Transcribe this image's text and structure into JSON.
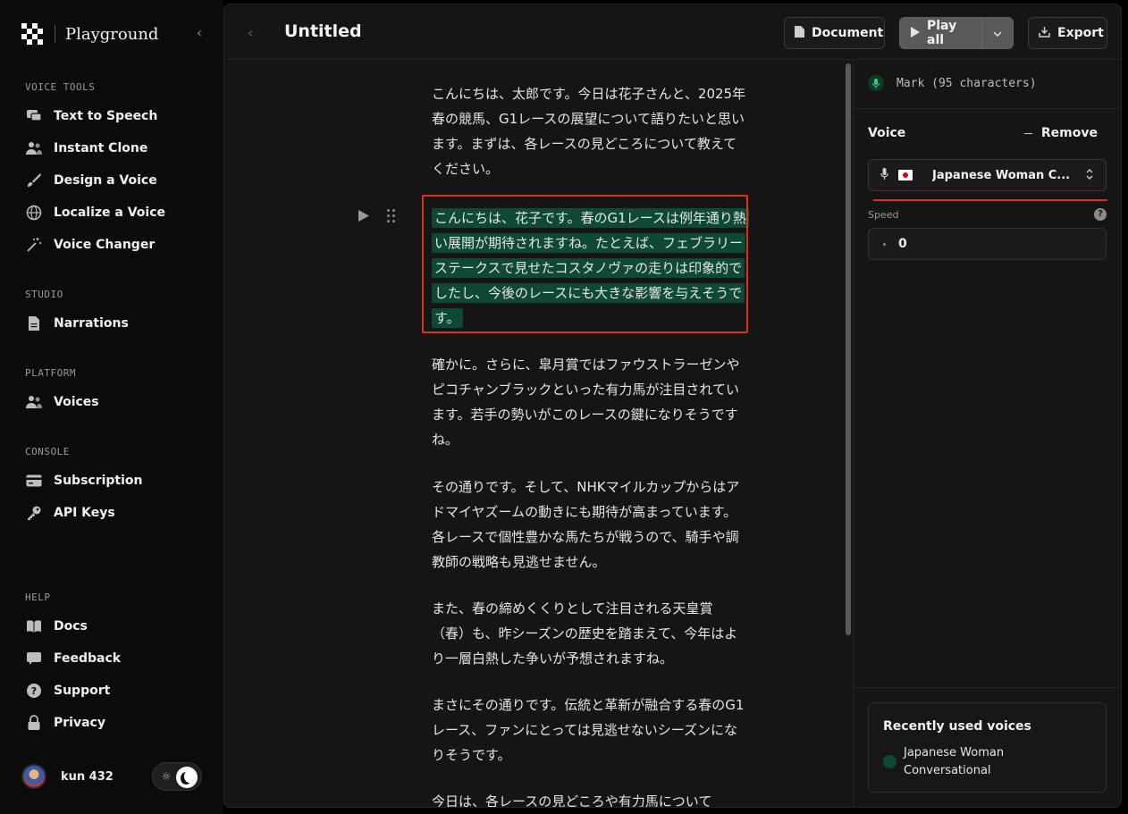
{
  "app": {
    "name": "Playground"
  },
  "sidebar": {
    "sections": [
      {
        "label": "VOICE TOOLS",
        "items": [
          {
            "label": "Text to Speech",
            "icon": "speech-bubble-icon"
          },
          {
            "label": "Instant Clone",
            "icon": "users-icon"
          },
          {
            "label": "Design a Voice",
            "icon": "brush-icon"
          },
          {
            "label": "Localize a Voice",
            "icon": "globe-icon"
          },
          {
            "label": "Voice Changer",
            "icon": "magic-wand-icon"
          }
        ]
      },
      {
        "label": "STUDIO",
        "items": [
          {
            "label": "Narrations",
            "icon": "document-icon"
          }
        ]
      },
      {
        "label": "PLATFORM",
        "items": [
          {
            "label": "Voices",
            "icon": "users-icon"
          }
        ]
      },
      {
        "label": "CONSOLE",
        "items": [
          {
            "label": "Subscription",
            "icon": "credit-card-icon"
          },
          {
            "label": "API Keys",
            "icon": "key-icon"
          }
        ]
      },
      {
        "label": "HELP",
        "items": [
          {
            "label": "Docs",
            "icon": "book-icon"
          },
          {
            "label": "Feedback",
            "icon": "chat-icon"
          },
          {
            "label": "Support",
            "icon": "question-icon"
          },
          {
            "label": "Privacy",
            "icon": "lock-icon"
          }
        ]
      }
    ],
    "user": {
      "name": "kun 432"
    }
  },
  "document": {
    "title": "Untitled",
    "buttons": {
      "document": "Document",
      "play_all": "Play all",
      "export": "Export"
    },
    "paragraphs": [
      "こんにちは、太郎です。今日は花子さんと、2025年春の競馬、G1レースの展望について語りたいと思います。まずは、各レースの見どころについて教えてください。",
      "こんにちは、花子です。春のG1レースは例年通り熱い展開が期待されますね。たとえば、フェブラリーステークスで見せたコスタノヴァの走りは印象的でしたし、今後のレースにも大きな影響を与えそうです。",
      "確かに。さらに、皐月賞ではファウストラーゼンやピコチャンブラックといった有力馬が注目されています。若手の勢いがこのレースの鍵になりそうですね。",
      "その通りです。そして、NHKマイルカップからはアドマイヤズームの動きにも期待が高まっています。各レースで個性豊かな馬たちが戦うので、騎手や調教師の戦略も見逃せません。",
      "また、春の締めくくりとして注目される天皇賞（春）も、昨シーズンの歴史を踏まえて、今年はより一層白熱した争いが予想されますね。",
      "まさにその通りです。伝統と革新が融合する春のG1レース、ファンにとっては見逃せないシーズンになりそうです。",
      "今日は、各レースの見どころや有力馬について"
    ],
    "selected_index": 1,
    "accent_highlight": "#0e4a33",
    "selection_border": "#e0311f"
  },
  "panel": {
    "mark": "Mark (95 characters)",
    "voice_label": "Voice",
    "remove_label": "Remove",
    "voice_value": "Japanese Woman C...",
    "speed_label": "Speed",
    "speed_value": "0",
    "recent_title": "Recently used voices",
    "recent_voices": [
      "Japanese Woman Conversational"
    ]
  }
}
